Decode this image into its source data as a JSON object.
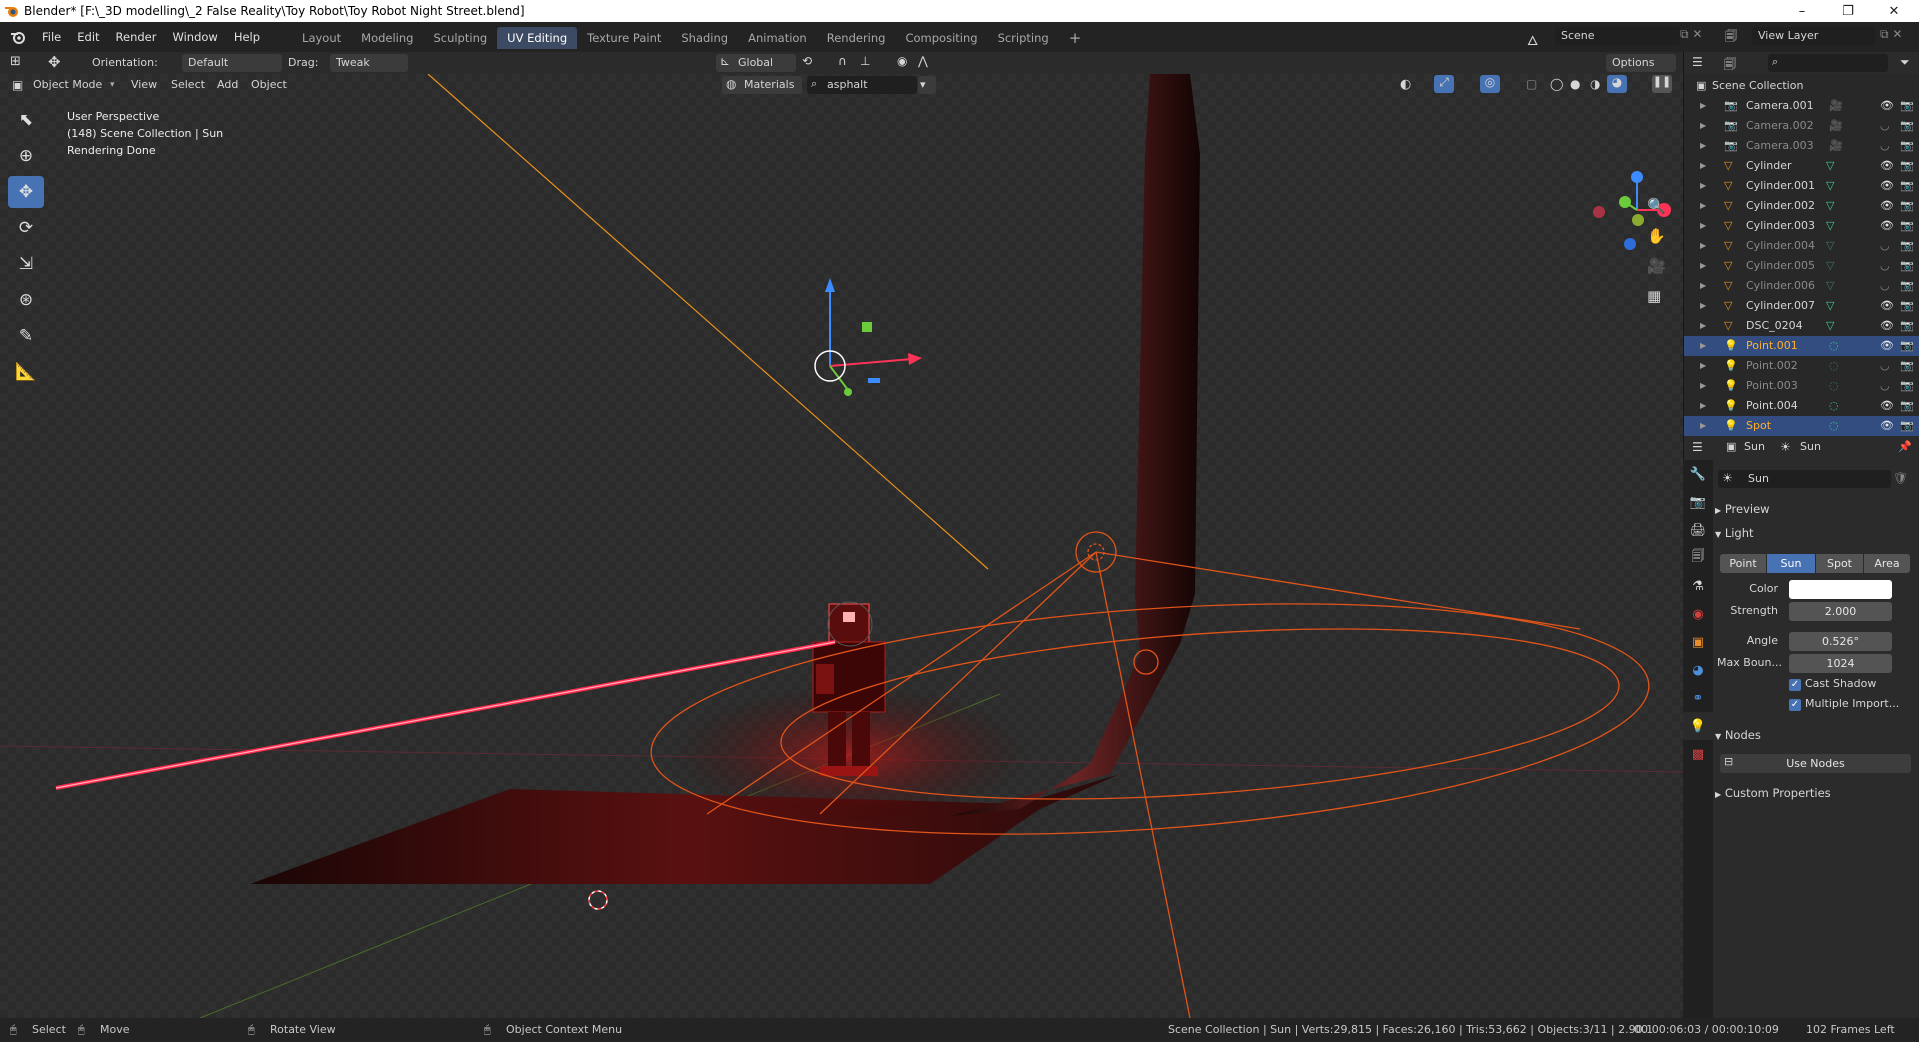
{
  "window": {
    "title": "Blender* [F:\\_3D modelling\\_2 False Reality\\Toy Robot\\Toy Robot Night Street.blend]",
    "minimize": "–",
    "maximize": "❐",
    "close": "✕"
  },
  "menu": [
    "File",
    "Edit",
    "Render",
    "Window",
    "Help"
  ],
  "workspaces": [
    {
      "label": "Layout",
      "active": false
    },
    {
      "label": "Modeling",
      "active": false
    },
    {
      "label": "Sculpting",
      "active": false
    },
    {
      "label": "UV Editing",
      "active": true
    },
    {
      "label": "Texture Paint",
      "active": false
    },
    {
      "label": "Shading",
      "active": false
    },
    {
      "label": "Animation",
      "active": false
    },
    {
      "label": "Rendering",
      "active": false
    },
    {
      "label": "Compositing",
      "active": false
    },
    {
      "label": "Scripting",
      "active": false
    }
  ],
  "add_workspace": "+",
  "scene": {
    "name": "Scene",
    "view_layer": "View Layer"
  },
  "tool_header": {
    "orientation_label": "Orientation:",
    "orientation_value": "Default",
    "drag_label": "Drag:",
    "drag_value": "Tweak",
    "transform_space": "Global",
    "options": "Options"
  },
  "viewport_header": {
    "mode": "Object Mode",
    "menus": [
      "View",
      "Select",
      "Add",
      "Object"
    ],
    "material_mode": "Materials",
    "material_search": "asphalt"
  },
  "viewport_info": {
    "line1": "User Perspective",
    "line2": "(148) Scene Collection | Sun",
    "line3": "Rendering Done"
  },
  "outliner": {
    "root": "Scene Collection",
    "items": [
      {
        "name": "Camera.001",
        "type": "camera",
        "state": "normal",
        "visible": true
      },
      {
        "name": "Camera.002",
        "type": "camera",
        "state": "dim",
        "visible": false
      },
      {
        "name": "Camera.003",
        "type": "camera",
        "state": "dim",
        "visible": false
      },
      {
        "name": "Cylinder",
        "type": "mesh",
        "state": "normal",
        "visible": true
      },
      {
        "name": "Cylinder.001",
        "type": "mesh",
        "state": "normal",
        "visible": true
      },
      {
        "name": "Cylinder.002",
        "type": "mesh",
        "state": "normal",
        "visible": true
      },
      {
        "name": "Cylinder.003",
        "type": "mesh",
        "state": "normal",
        "visible": true
      },
      {
        "name": "Cylinder.004",
        "type": "mesh",
        "state": "dim",
        "visible": false
      },
      {
        "name": "Cylinder.005",
        "type": "mesh",
        "state": "dim",
        "visible": false
      },
      {
        "name": "Cylinder.006",
        "type": "mesh",
        "state": "dim",
        "visible": false
      },
      {
        "name": "Cylinder.007",
        "type": "mesh",
        "state": "normal",
        "visible": true
      },
      {
        "name": "DSC_0204",
        "type": "mesh",
        "state": "normal",
        "visible": true
      },
      {
        "name": "Point.001",
        "type": "light",
        "state": "selected",
        "visible": true
      },
      {
        "name": "Point.002",
        "type": "light",
        "state": "dim",
        "visible": false
      },
      {
        "name": "Point.003",
        "type": "light",
        "state": "dim",
        "visible": false
      },
      {
        "name": "Point.004",
        "type": "light",
        "state": "normal",
        "visible": true
      },
      {
        "name": "Spot",
        "type": "light",
        "state": "selected",
        "visible": true
      }
    ]
  },
  "properties": {
    "breadcrumb_object": "Sun",
    "breadcrumb_data": "Sun",
    "data_name": "Sun",
    "sections": {
      "preview": "Preview",
      "light": "Light",
      "nodes": "Nodes",
      "custom": "Custom Properties"
    },
    "light_types": [
      "Point",
      "Sun",
      "Spot",
      "Area"
    ],
    "light_type_active": "Sun",
    "fields": {
      "color_label": "Color",
      "strength_label": "Strength",
      "strength_value": "2.000",
      "angle_label": "Angle",
      "angle_value": "0.526°",
      "max_bounces_label": "Max Boun...",
      "max_bounces_value": "1024",
      "cast_shadow": "Cast Shadow",
      "multiple_importance": "Multiple Import..."
    },
    "use_nodes": "Use Nodes"
  },
  "statusbar": {
    "select": "Select",
    "move": "Move",
    "rotate": "Rotate View",
    "context": "Object Context Menu",
    "stats": "Scene Collection | Sun | Verts:29,815 | Faces:26,160 | Tris:53,662 | Objects:3/11 | 2.90.1",
    "time": "00:00:06:03 / 00:00:10:09",
    "frames_left": "102 Frames Left"
  },
  "colors": {
    "accent": "#4772b3",
    "selected_row": "#334d80",
    "highlight_text": "#ffaf29",
    "light_orange": "#ff7a1a",
    "laser_red": "#ff4060"
  }
}
